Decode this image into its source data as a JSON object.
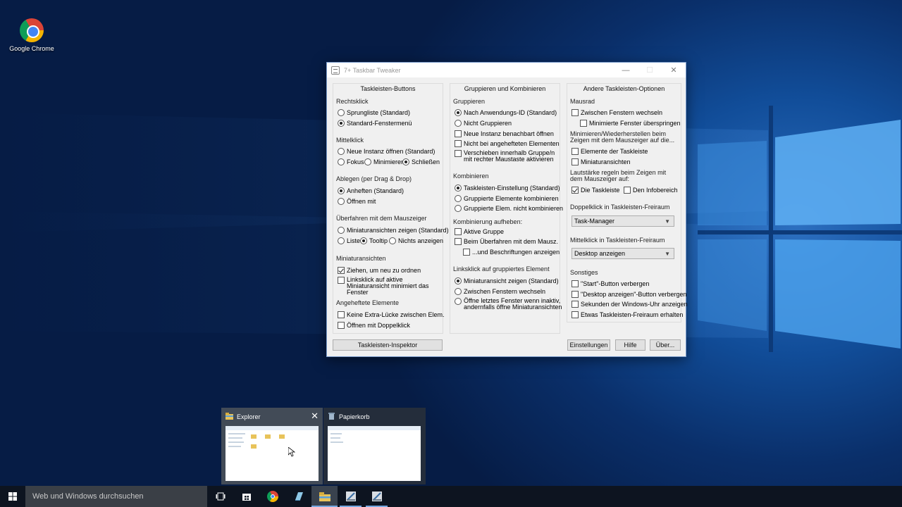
{
  "desktop": {
    "icons": [
      {
        "label": "Google Chrome"
      }
    ]
  },
  "window": {
    "title": "7+ Taskbar Tweaker",
    "buttons": {
      "minimize": "—",
      "maximize": "☐",
      "close": "✕"
    },
    "col1": {
      "title": "Taskleisten-Buttons",
      "rechtsklick": {
        "label": "Rechtsklick",
        "opt1": "Sprungliste (Standard)",
        "opt2": "Standard-Fenstermenü"
      },
      "mittelklick": {
        "label": "Mittelklick",
        "opt1": "Neue Instanz öffnen (Standard)",
        "opt2": "Fokus",
        "opt3": "Minimieren",
        "opt4": "Schließen"
      },
      "ablegen": {
        "label": "Ablegen (per Drag & Drop)",
        "opt1": "Anheften (Standard)",
        "opt2": "Öffnen mit"
      },
      "ueberfahren": {
        "label": "Überfahren mit dem Mauszeiger",
        "opt1": "Miniaturansichten zeigen (Standard)",
        "opt2": "Liste",
        "opt3": "Tooltip",
        "opt4": "Nichts anzeigen"
      },
      "miniaturansichten": {
        "label": "Miniaturansichten",
        "opt1": "Ziehen, um neu zu ordnen",
        "opt2": "Linksklick auf aktive Miniaturansicht minimiert das Fenster"
      },
      "angeheftete": {
        "label": "Angeheftete Elemente",
        "opt1": "Keine Extra-Lücke zwischen Elem.",
        "opt2": "Öffnen mit Doppelklick"
      }
    },
    "col2": {
      "title": "Gruppieren und Kombinieren",
      "gruppieren": {
        "label": "Gruppieren",
        "opt1": "Nach Anwendungs-ID (Standard)",
        "opt2": "Nicht Gruppieren",
        "opt3": "Neue Instanz benachbart öffnen",
        "opt4": "Nicht bei angehefteten Elementen",
        "opt5": "Verschieben innerhalb Gruppe/n mit rechter Maustaste aktivieren"
      },
      "kombinieren": {
        "label": "Kombinieren",
        "opt1": "Taskleisten-Einstellung (Standard)",
        "opt2": "Gruppierte Elemente kombinieren",
        "opt3": "Gruppierte Elem. nicht kombinieren"
      },
      "aufheben": {
        "label": "Kombinierung aufheben:",
        "opt1": "Aktive Gruppe",
        "opt2": "Beim Überfahren mit dem Mausz.",
        "opt3": "...und Beschriftungen anzeigen"
      },
      "linksklick": {
        "label": "Linksklick auf gruppiertes Element",
        "opt1": "Miniaturansicht zeigen (Standard)",
        "opt2": "Zwischen Fenstern wechseln",
        "opt3": "Öffne letztes Fenster wenn inaktiv, andernfalls öffne Miniaturansichten"
      }
    },
    "col3": {
      "title": "Andere Taskleisten-Optionen",
      "mausrad": {
        "label": "Mausrad",
        "opt1": "Zwischen Fenstern wechseln",
        "opt2": "Minimierte Fenster überspringen"
      },
      "minimieren": {
        "label": "Minimieren/Wiederherstellen beim Zeigen mit dem Mauszeiger auf die...",
        "opt1": "Elemente der Taskleiste",
        "opt2": "Miniaturansichten"
      },
      "lautstaerke": {
        "label": "Lautstärke regeln beim Zeigen mit dem Mauszeiger auf:",
        "opt1": "Die Taskleiste",
        "opt2": "Den Infobereich"
      },
      "doppelklick": {
        "label": "Doppelklick in Taskleisten-Freiraum",
        "value": "Task-Manager"
      },
      "mittelklick": {
        "label": "Mittelklick in Taskleisten-Freiraum",
        "value": "Desktop anzeigen"
      },
      "sonstiges": {
        "label": "Sonstiges",
        "opt1": "\"Start\"-Button verbergen",
        "opt2": "\"Desktop anzeigen\"-Button verbergen",
        "opt3": "Sekunden der Windows-Uhr anzeigen",
        "opt4": "Etwas Taskleisten-Freiraum erhalten"
      }
    },
    "footer": {
      "inspector": "Taskleisten-Inspektor",
      "settings": "Einstellungen",
      "help": "Hilfe",
      "about": "Über..."
    }
  },
  "thumbnails": [
    {
      "title": "Explorer",
      "close": "✕"
    },
    {
      "title": "Papierkorb"
    }
  ],
  "taskbar": {
    "search_placeholder": "Web und Windows durchsuchen"
  }
}
